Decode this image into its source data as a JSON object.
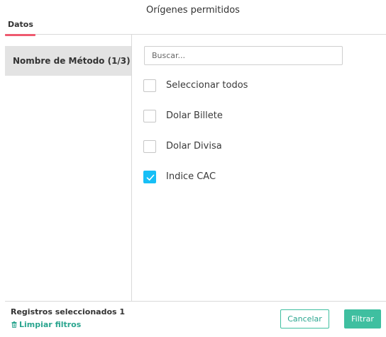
{
  "dialog": {
    "title": "Orígenes permitidos"
  },
  "tabs": [
    {
      "label": "Datos"
    }
  ],
  "sidebar": {
    "items": [
      {
        "label": "Nombre de Método (1/3)"
      }
    ]
  },
  "search": {
    "placeholder": "Buscar..."
  },
  "options": [
    {
      "label": "Seleccionar todos",
      "checked": false
    },
    {
      "label": "Dolar Billete",
      "checked": false
    },
    {
      "label": "Dolar Divisa",
      "checked": false
    },
    {
      "label": "Indice CAC",
      "checked": true
    }
  ],
  "footer": {
    "selected_count": "Registros seleccionados 1",
    "clear_label": "Limpiar filtros",
    "clear_icon": "trash-icon",
    "cancel_label": "Cancelar",
    "filter_label": "Filtrar"
  },
  "colors": {
    "accent": "#3fbfa0",
    "checkbox_checked": "#17bff6",
    "tab_underline": "#ee5a6f"
  }
}
